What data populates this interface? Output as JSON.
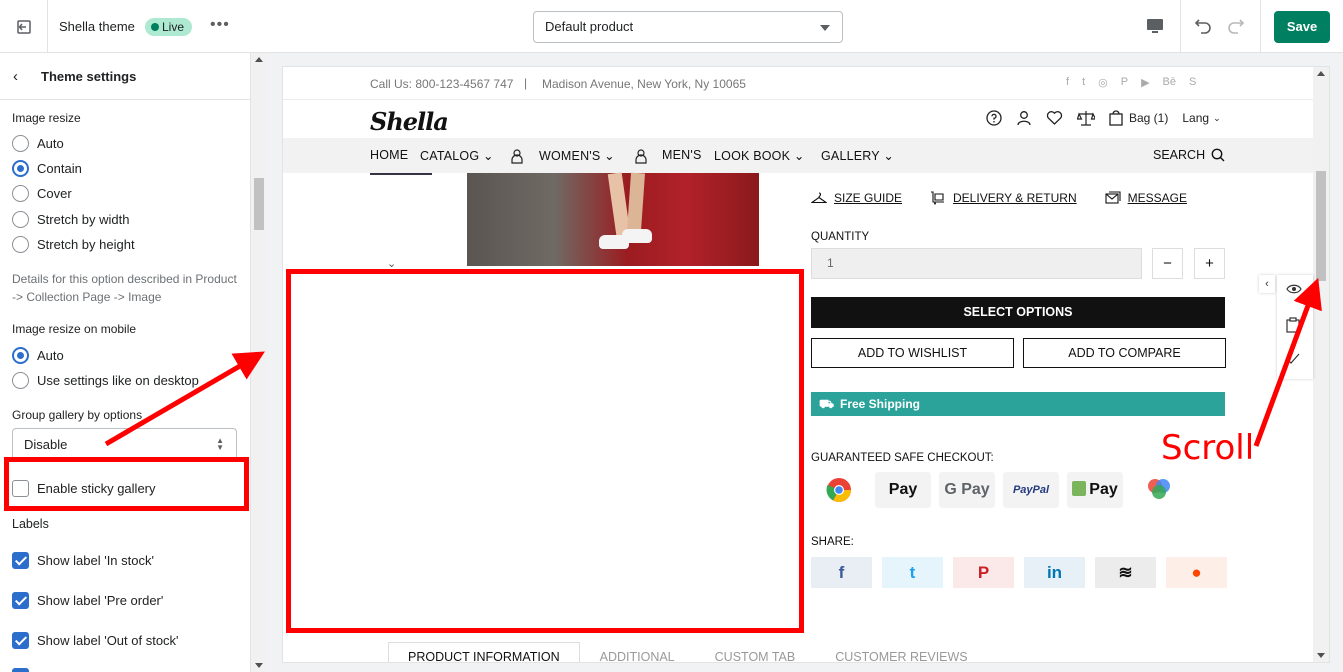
{
  "topbar": {
    "theme_name": "Shella theme",
    "status_badge": "Live",
    "more_label": "•••",
    "template_select": "Default product",
    "save_label": "Save"
  },
  "sidebar": {
    "back_label": "Theme settings",
    "image_resize": {
      "label": "Image resize",
      "options": [
        "Auto",
        "Contain",
        "Cover",
        "Stretch by width",
        "Stretch by height"
      ],
      "selected": "Contain"
    },
    "resize_note": "Details for this option described in Product -> Collection Page -> Image",
    "image_resize_mobile": {
      "label": "Image resize on mobile",
      "options": [
        "Auto",
        "Use settings like on desktop"
      ],
      "selected": "Auto"
    },
    "group_gallery": {
      "label": "Group gallery by options",
      "value": "Disable"
    },
    "sticky_gallery": {
      "label": "Enable sticky gallery",
      "checked": false
    },
    "labels_heading": "Labels",
    "label_checks": [
      {
        "label": "Show label 'In stock'",
        "checked": true
      },
      {
        "label": "Show label 'Pre order'",
        "checked": true
      },
      {
        "label": "Show label 'Out of stock'",
        "checked": true
      }
    ]
  },
  "preview": {
    "announcement": {
      "phone": "Call Us: 800-123-4567 747",
      "separator": "|",
      "address": "Madison Avenue, New York, Ny 10065",
      "social_icons": [
        "f",
        "t",
        "◎",
        "P",
        "▶",
        "Bē",
        "S"
      ]
    },
    "logo": "Shella",
    "header": {
      "bag": "Bag (1)",
      "lang": "Lang"
    },
    "nav": {
      "items": [
        "HOME",
        "CATALOG",
        "WOMEN'S",
        "MEN'S",
        "LOOK BOOK",
        "GALLERY"
      ],
      "search": "SEARCH"
    },
    "product": {
      "links": [
        "SIZE GUIDE",
        "DELIVERY & RETURN",
        "MESSAGE"
      ],
      "quantity_label": "QUANTITY",
      "quantity_value": "1",
      "minus": "−",
      "plus": "+",
      "select_options": "SELECT OPTIONS",
      "add_to_wishlist": "ADD TO WISHLIST",
      "add_to_compare": "ADD TO COMPARE",
      "free_shipping": "Free Shipping",
      "guaranteed": "GUARANTEED SAFE CHECKOUT:",
      "payments": [
        "",
        " Pay",
        "G Pay",
        "PayPal",
        "Pay",
        ""
      ],
      "share_label": "SHARE:",
      "share_icons": [
        "f",
        "t",
        "P",
        "in",
        "≋",
        "●"
      ],
      "tabs": [
        "PRODUCT INFORMATION",
        "ADDITIONAL",
        "CUSTOM TAB",
        "CUSTOMER REVIEWS"
      ]
    }
  },
  "annotation": {
    "scroll_label": "Scroll"
  },
  "colors": {
    "save_button": "#008060",
    "live_badge": "#aee9d1",
    "free_shipping": "#2ba39a",
    "highlight": "#ff0000",
    "checkbox_on": "#2c6ecb"
  }
}
